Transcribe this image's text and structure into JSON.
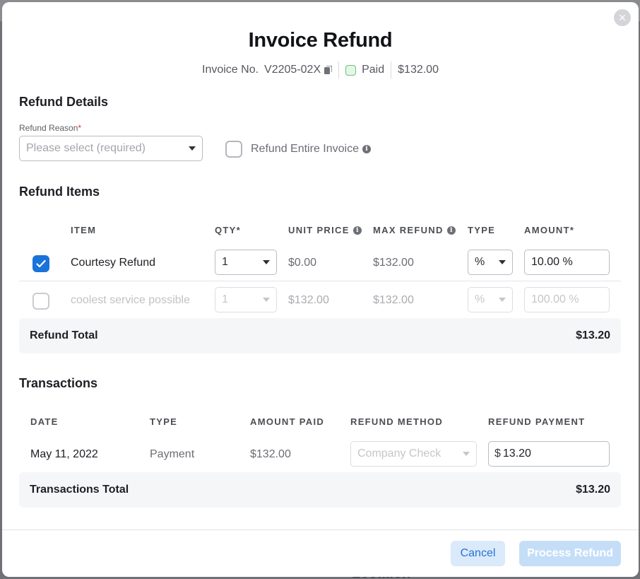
{
  "modal": {
    "title": "Invoice Refund",
    "close_glyph": "×",
    "invoice_label": "Invoice No.",
    "invoice_number": "V2205-02X",
    "status": "Paid",
    "invoice_amount": "$132.00"
  },
  "refund_details": {
    "section_title": "Refund Details",
    "reason_label": "Refund Reason",
    "required_mark": "*",
    "reason_placeholder": "Please select (required)",
    "entire_invoice_label": "Refund Entire Invoice",
    "entire_invoice_checked": false
  },
  "refund_items": {
    "section_title": "Refund Items",
    "headers": {
      "item": "ITEM",
      "qty": "QTY*",
      "unit_price": "UNIT PRICE",
      "max_refund": "MAX REFUND",
      "type": "TYPE",
      "amount": "AMOUNT*"
    },
    "rows": [
      {
        "checked": true,
        "item": "Courtesy Refund",
        "qty": "1",
        "unit_price": "$0.00",
        "max_refund": "$132.00",
        "type": "%",
        "amount": "10.00 %"
      },
      {
        "checked": false,
        "item": "coolest service possible",
        "qty": "1",
        "unit_price": "$132.00",
        "max_refund": "$132.00",
        "type": "%",
        "amount": "100.00 %"
      }
    ],
    "total_label": "Refund Total",
    "total_value": "$13.20"
  },
  "transactions": {
    "section_title": "Transactions",
    "headers": {
      "date": "DATE",
      "type": "TYPE",
      "amount_paid": "AMOUNT PAID",
      "refund_method": "REFUND METHOD",
      "refund_payment": "REFUND PAYMENT"
    },
    "rows": [
      {
        "date": "May 11, 2022",
        "type": "Payment",
        "amount_paid": "$132.00",
        "refund_method": "Company Check",
        "currency": "$",
        "refund_payment": "13.20"
      }
    ],
    "total_label": "Transactions Total",
    "total_value": "$13.20"
  },
  "footer": {
    "cancel_label": "Cancel",
    "process_label": "Process Refund"
  },
  "colors": {
    "accent": "#1a73d9",
    "paid_green": "#6cc07a"
  },
  "icons": [
    "close-icon",
    "copy-icon",
    "info-icon",
    "check-icon",
    "chevron-down-icon"
  ]
}
